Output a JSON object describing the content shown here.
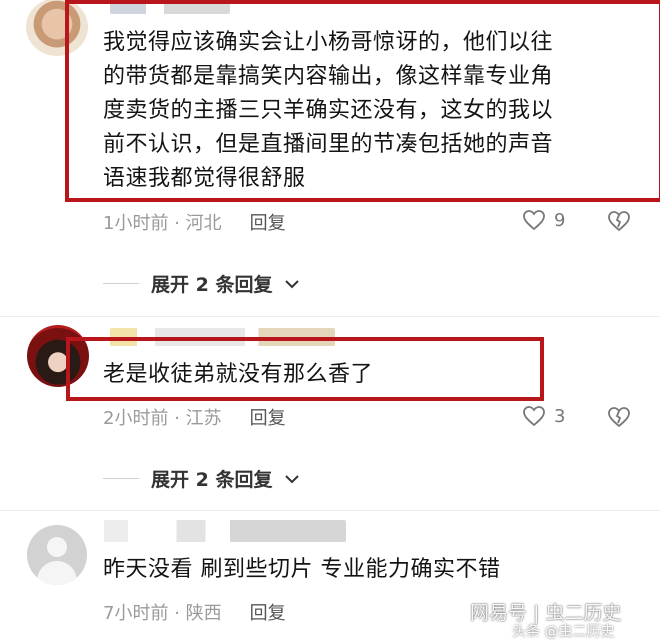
{
  "comments": [
    {
      "text_lines": [
        "我觉得应该确实会让小杨哥惊讶的，他们以往",
        "的带货都是靠搞笑内容输出，像这样靠专业角",
        "度卖货的主播三只羊确实还没有，这女的我以",
        "前不认识，但是直播间里的节凑包括她的声音",
        "语速我都觉得很舒服"
      ],
      "time": "1小时前",
      "location": "河北",
      "reply_label": "回复",
      "likes": "9",
      "expand_label": "展开 2 条回复"
    },
    {
      "text_lines": [
        "老是收徒弟就没有那么香了"
      ],
      "time": "2小时前",
      "location": "江苏",
      "reply_label": "回复",
      "likes": "3",
      "expand_label": "展开 2 条回复"
    },
    {
      "text_lines": [
        "昨天没看 刷到些切片 专业能力确实不错"
      ],
      "time": "7小时前",
      "location": "陕西",
      "reply_label": "回复"
    }
  ],
  "separator": "·",
  "icons": {
    "like": "heart-outline-icon",
    "dislike": "broken-heart-icon",
    "expand": "chevron-down-icon",
    "avatar_placeholder": "person-icon"
  },
  "colors": {
    "highlight_box": "#b8161b",
    "meta_text": "#9a9a9a"
  },
  "watermark": {
    "main": "网易号 | 虫二历史",
    "sub": "头条 @虫二历史"
  }
}
